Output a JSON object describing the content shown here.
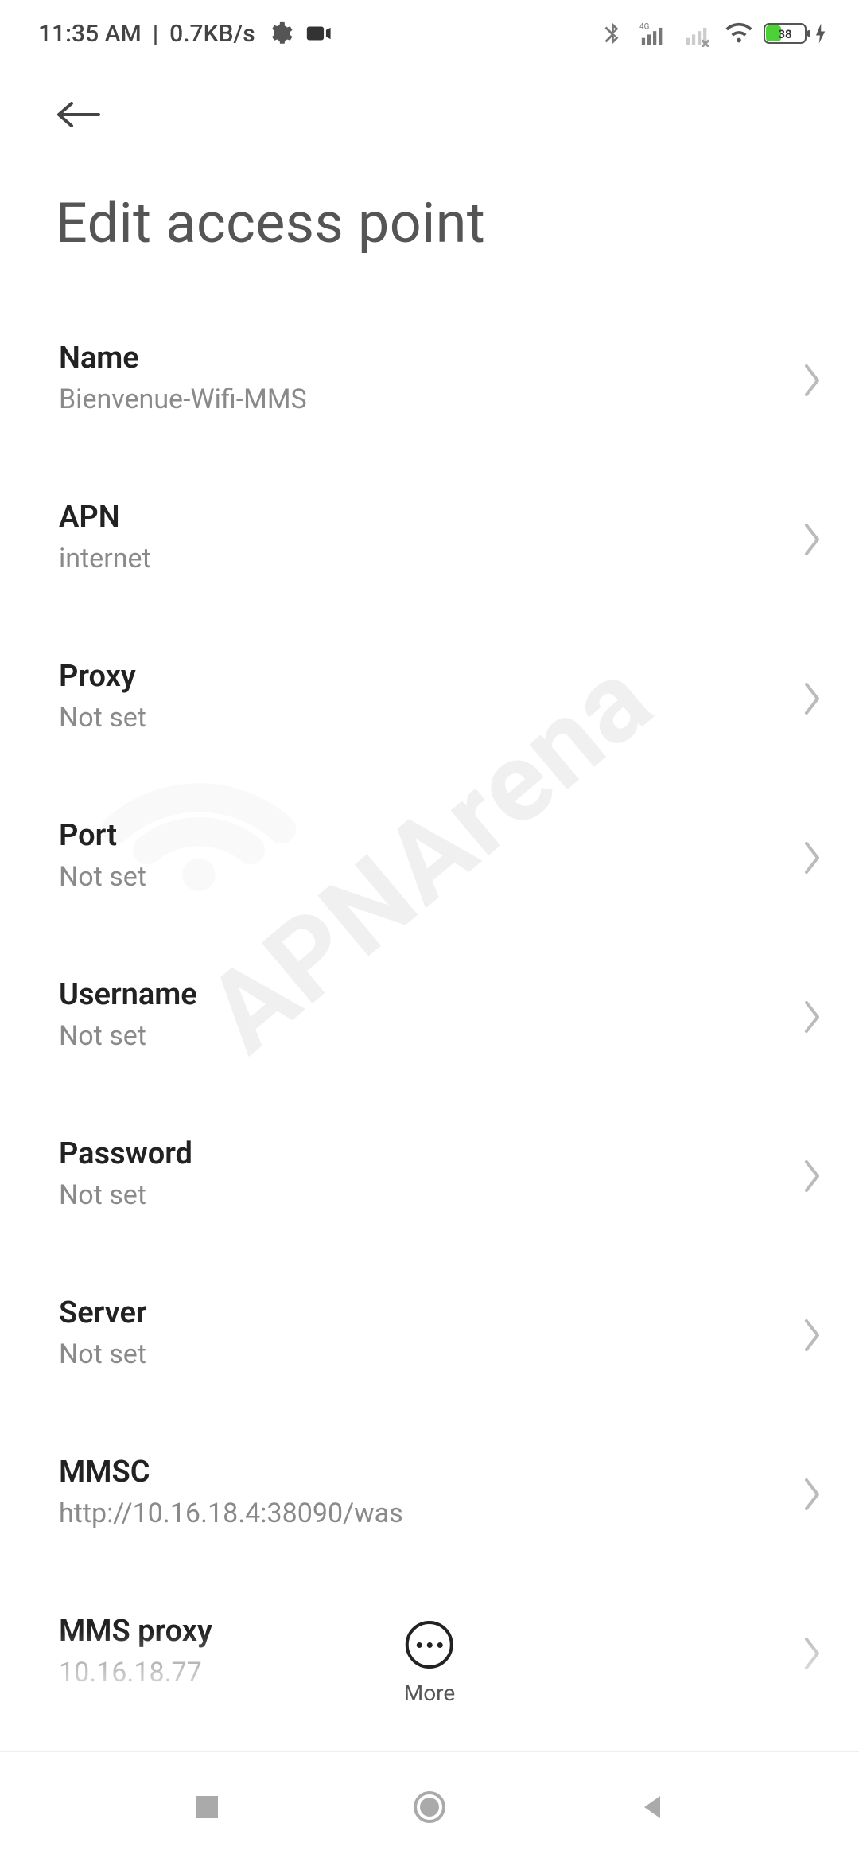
{
  "status": {
    "time": "11:35 AM",
    "separator": "|",
    "rate": "0.7KB/s",
    "battery_pct": "38"
  },
  "header": {
    "title": "Edit access point"
  },
  "rows": [
    {
      "label": "Name",
      "value": "Bienvenue-Wifi-MMS"
    },
    {
      "label": "APN",
      "value": "internet"
    },
    {
      "label": "Proxy",
      "value": "Not set"
    },
    {
      "label": "Port",
      "value": "Not set"
    },
    {
      "label": "Username",
      "value": "Not set"
    },
    {
      "label": "Password",
      "value": "Not set"
    },
    {
      "label": "Server",
      "value": "Not set"
    },
    {
      "label": "MMSC",
      "value": "http://10.16.18.4:38090/was"
    },
    {
      "label": "MMS proxy",
      "value": "10.16.18.77"
    }
  ],
  "fab": {
    "label": "More"
  },
  "watermark": "APNArena"
}
